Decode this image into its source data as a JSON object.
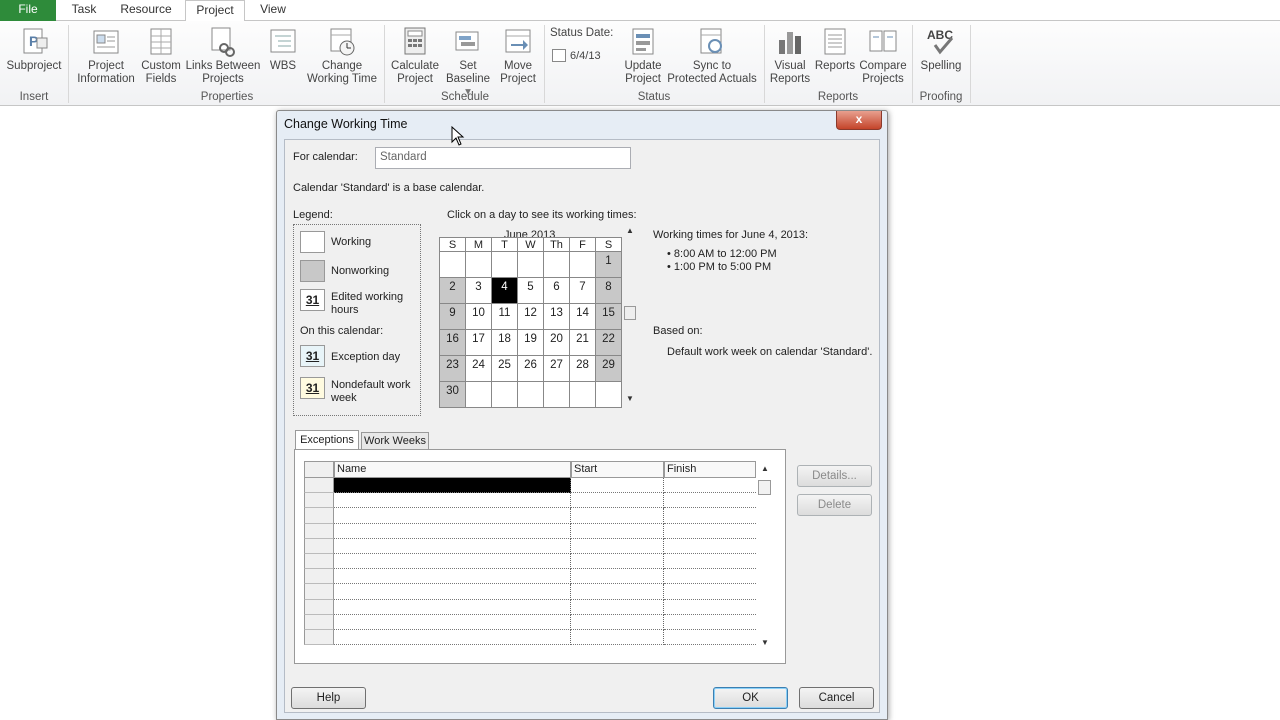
{
  "tabs": [
    {
      "label": "File"
    },
    {
      "label": "Task"
    },
    {
      "label": "Resource"
    },
    {
      "label": "Project"
    },
    {
      "label": "View"
    }
  ],
  "ribbon": {
    "buttons": {
      "subproject": "Subproject",
      "project_information_l1": "Project",
      "project_information_l2": "Information",
      "custom_fields_l1": "Custom",
      "custom_fields_l2": "Fields",
      "links_l1": "Links Between",
      "links_l2": "Projects",
      "wbs": "WBS",
      "change_wt_l1": "Change",
      "change_wt_l2": "Working Time",
      "calc_l1": "Calculate",
      "calc_l2": "Project",
      "set_baseline_l1": "Set",
      "set_baseline_l2": "Baseline",
      "move_l1": "Move",
      "move_l2": "Project",
      "status_date_label": "Status Date:",
      "status_date_value": "6/4/13",
      "update_l1": "Update",
      "update_l2": "Project",
      "sync_l1": "Sync to",
      "sync_l2": "Protected Actuals",
      "visual_l1": "Visual",
      "visual_l2": "Reports",
      "reports": "Reports",
      "compare_l1": "Compare",
      "compare_l2": "Projects",
      "spelling": "Spelling",
      "abc": "ABC"
    },
    "groups": {
      "insert": "Insert",
      "properties": "Properties",
      "schedule": "Schedule",
      "status": "Status",
      "reports": "Reports",
      "proofing": "Proofing"
    }
  },
  "dialog": {
    "title": "Change Working Time",
    "close": "x",
    "for_calendar_label": "For calendar:",
    "for_calendar_value": "Standard",
    "base_note": "Calendar 'Standard' is a base calendar.",
    "legend_label": "Legend:",
    "legend": {
      "working": "Working",
      "nonworking": "Nonworking",
      "edited_l1": "Edited working",
      "edited_l2": "hours",
      "on_this_calendar": "On this calendar:",
      "exception": "Exception day",
      "nondefault_l1": "Nondefault work",
      "nondefault_l2": "week",
      "num": "31"
    },
    "click_hint": "Click on a day to see its working times:",
    "calendar": {
      "month": "June 2013",
      "days": [
        "S",
        "M",
        "T",
        "W",
        "Th",
        "F",
        "S"
      ],
      "weeks": [
        [
          "",
          "",
          "",
          "",
          "",
          "",
          "1"
        ],
        [
          "2",
          "3",
          "4",
          "5",
          "6",
          "7",
          "8"
        ],
        [
          "9",
          "10",
          "11",
          "12",
          "13",
          "14",
          "15"
        ],
        [
          "16",
          "17",
          "18",
          "19",
          "20",
          "21",
          "22"
        ],
        [
          "23",
          "24",
          "25",
          "26",
          "27",
          "28",
          "29"
        ],
        [
          "30",
          "",
          "",
          "",
          "",
          "",
          ""
        ]
      ]
    },
    "working_times_title": "Working times for June 4, 2013:",
    "working_times": [
      "8:00 AM to 12:00 PM",
      "1:00 PM to 5:00 PM"
    ],
    "based_on_label": "Based on:",
    "based_on_value": "Default work week on calendar 'Standard'.",
    "tabs": {
      "exceptions": "Exceptions",
      "work_weeks": "Work Weeks"
    },
    "grid_headers": {
      "name": "Name",
      "start": "Start",
      "finish": "Finish"
    },
    "details_button": "Details...",
    "delete_button": "Delete",
    "help_button": "Help",
    "ok_button": "OK",
    "cancel_button": "Cancel"
  },
  "colors": {
    "file_tab": "#2e8b3a",
    "nonworking": "#c8c8c8",
    "selected_day": "#000000"
  }
}
